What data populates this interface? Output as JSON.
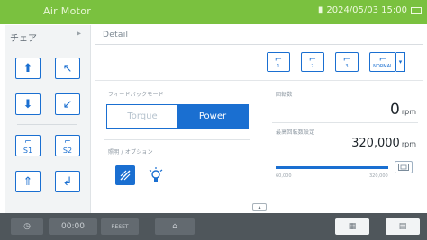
{
  "topbar": {
    "app_title": "Air Motor",
    "status": "2024/05/03 15:00"
  },
  "left_panel": {
    "title": "チェア",
    "modes": [
      {
        "name": "chair-up",
        "glyph": "⬆"
      },
      {
        "name": "chair-backrest-up",
        "glyph": "↖"
      },
      {
        "name": "chair-down",
        "glyph": "⬇"
      },
      {
        "name": "chair-backrest-down",
        "glyph": "↙"
      },
      {
        "name": "position-s1",
        "glyph": "S1"
      },
      {
        "name": "position-s2",
        "glyph": "S2"
      },
      {
        "name": "spittoon",
        "glyph": "⇑"
      },
      {
        "name": "return-position",
        "glyph": "↲"
      }
    ]
  },
  "detail": {
    "header": "Detail",
    "presets": [
      "1",
      "2",
      "3",
      "NORMAL"
    ],
    "feedback_label": "フィードバックモード",
    "toggle": {
      "off": "Torque",
      "on": "Power"
    },
    "light_label": "照明 / オプション",
    "speed_label": "回転数",
    "speed_value": "0",
    "speed_unit": "rpm",
    "max_label": "最高回転数設定",
    "max_value": "320,000",
    "max_unit": "rpm",
    "slider": {
      "min_label": "60,000",
      "max_label": "320,000",
      "fraction": 1.0
    }
  },
  "bottombar": {
    "timer": "00:00",
    "reset": "RESET",
    "grid_icon": "▦",
    "menu_icon": "▤"
  }
}
